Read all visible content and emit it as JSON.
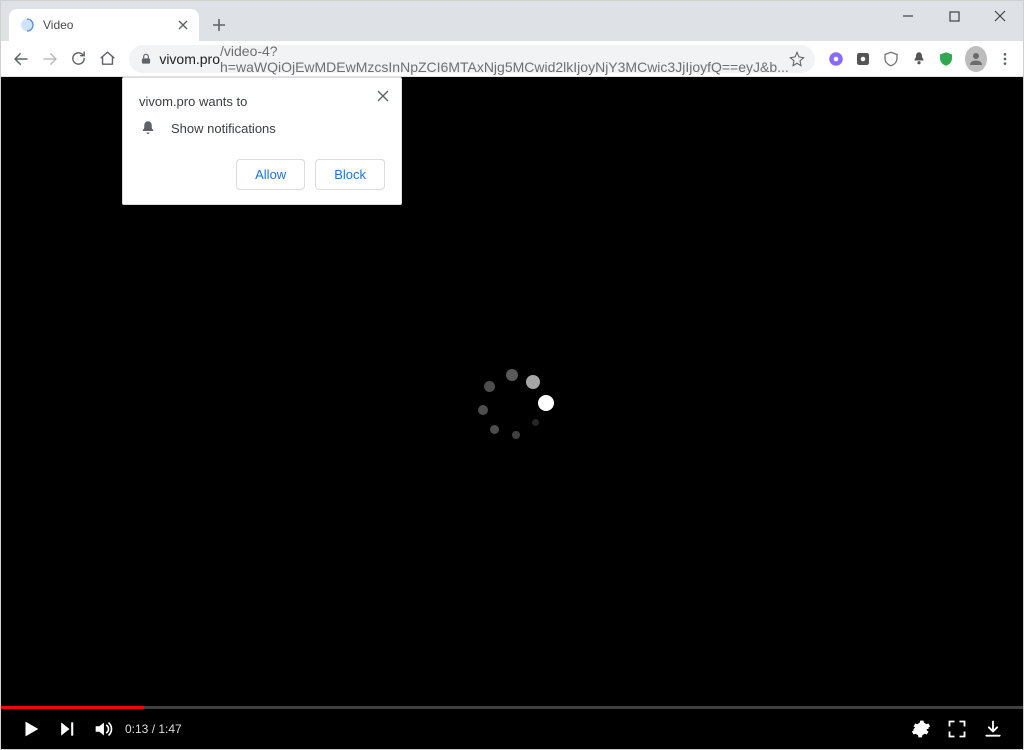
{
  "tab": {
    "title": "Video"
  },
  "url": {
    "domain": "vivom.pro",
    "path": "/video-4?h=waWQiOjEwMDEwMzcsInNpZCI6MTAxNjg5MCwid2lkIjoyNjY3MCwic3JjIjoyfQ==eyJ&b..."
  },
  "prompt": {
    "title": "vivom.pro wants to",
    "permission_label": "Show notifications",
    "allow_label": "Allow",
    "block_label": "Block"
  },
  "player": {
    "current_time": "0:13",
    "separator": " / ",
    "duration": "1:47",
    "progress_percent": 14
  }
}
